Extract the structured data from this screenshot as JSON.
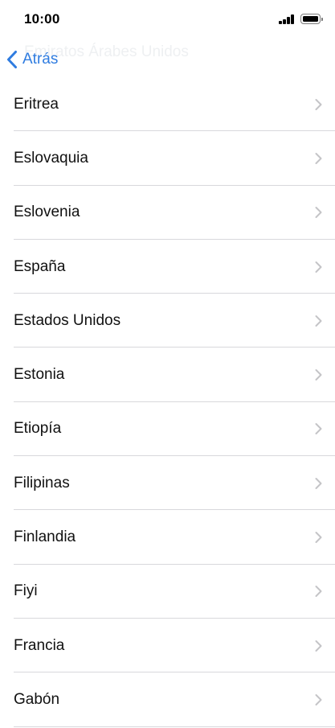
{
  "status_bar": {
    "time": "10:00"
  },
  "nav": {
    "title": "Emiratos Árabes Unidos",
    "back_label": "Atrás"
  },
  "countries": [
    "Eritrea",
    "Eslovaquia",
    "Eslovenia",
    "España",
    "Estados Unidos",
    "Estonia",
    "Etiopía",
    "Filipinas",
    "Finlandia",
    "Fiyi",
    "Francia",
    "Gabón"
  ],
  "colors": {
    "accent": "#2f7ce0",
    "divider": "#d8d8dc",
    "chevron": "#c4c4c7"
  }
}
